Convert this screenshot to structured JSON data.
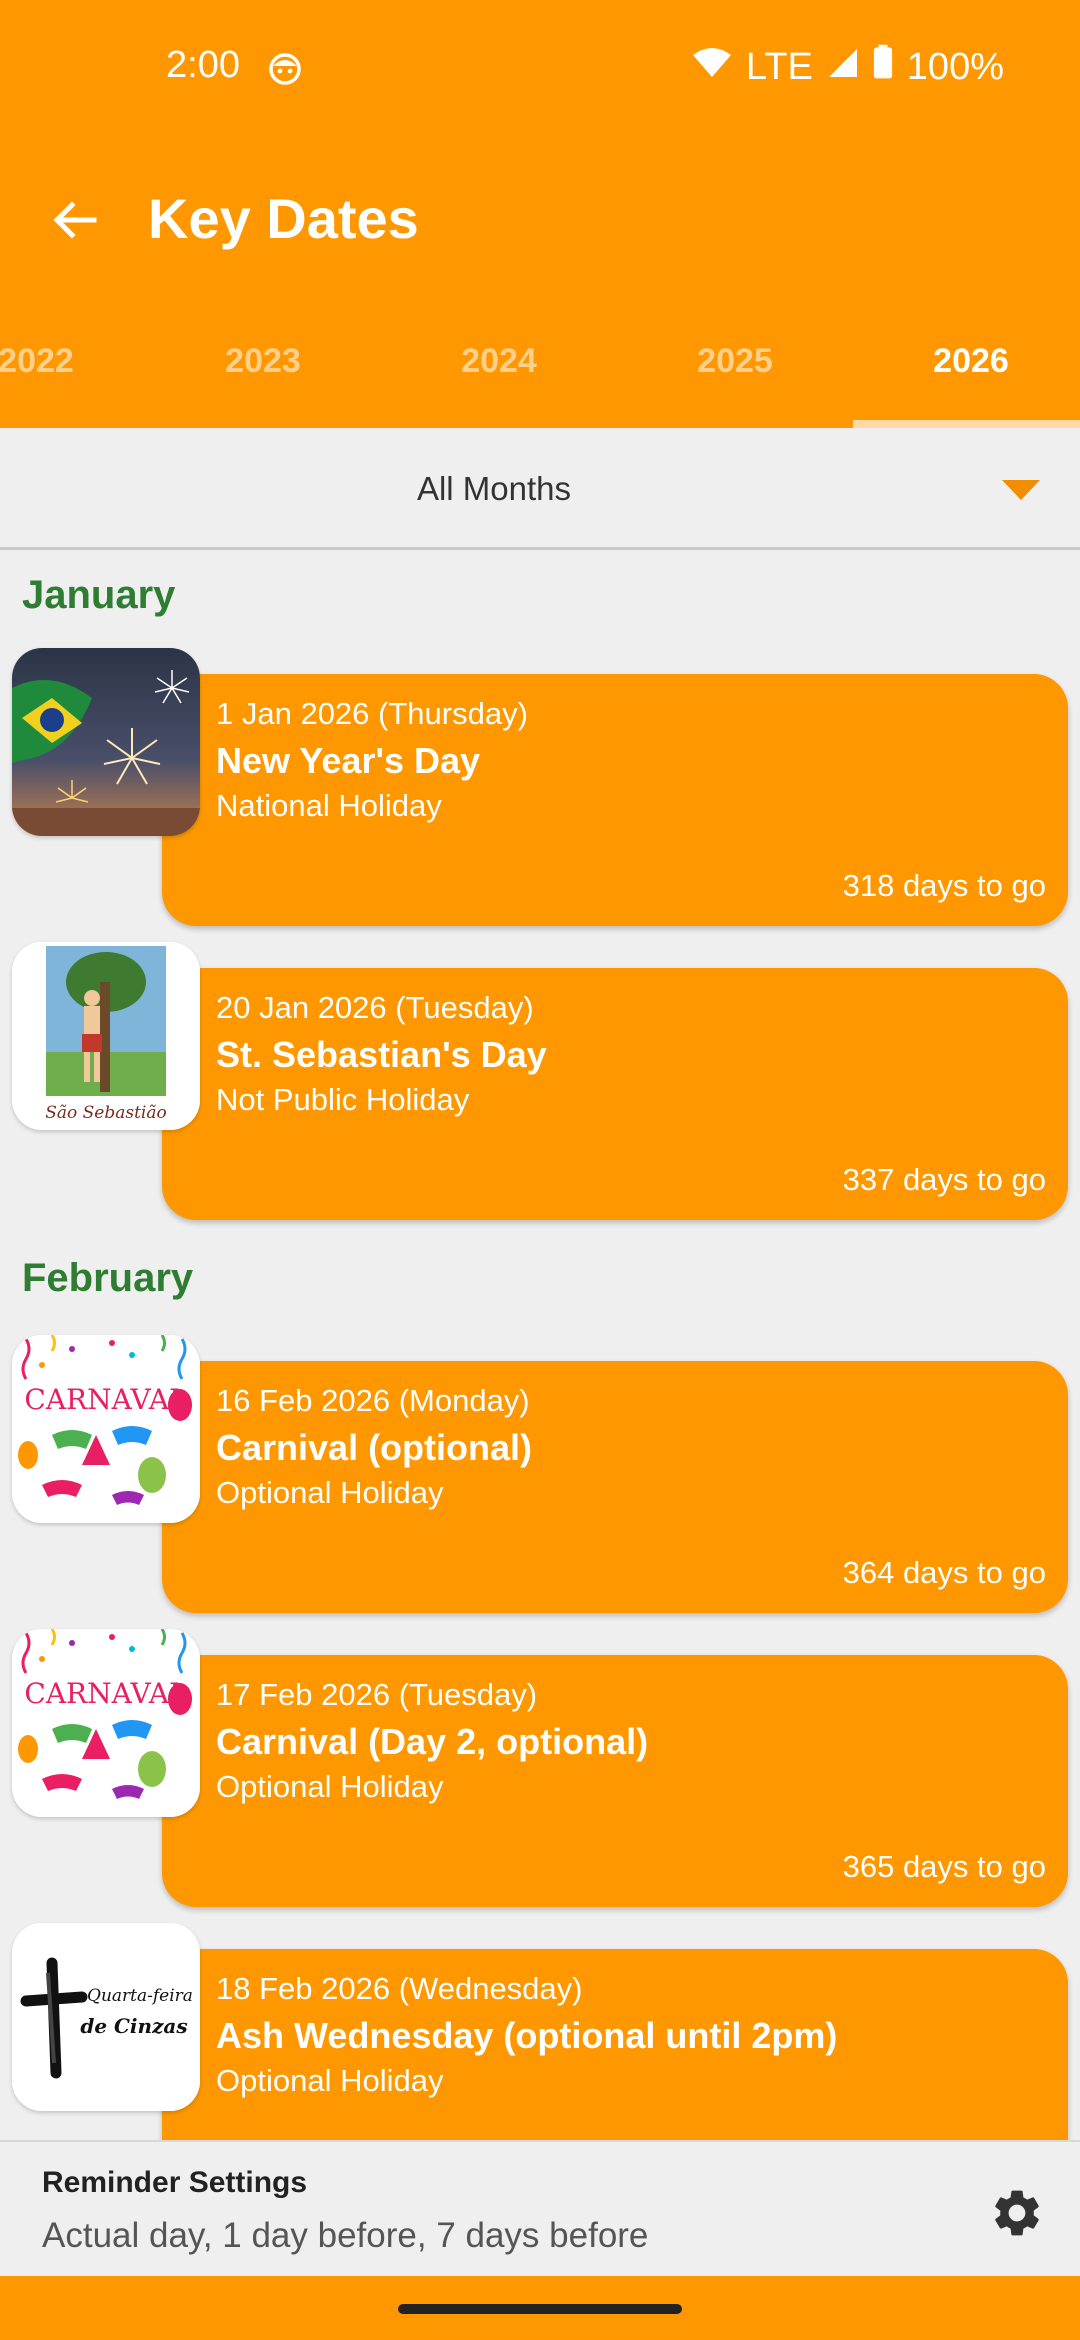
{
  "status": {
    "time": "2:00",
    "network": "LTE",
    "battery": "100%"
  },
  "toolbar": {
    "title": "Key Dates"
  },
  "tabs": [
    {
      "label": "2022"
    },
    {
      "label": "2023"
    },
    {
      "label": "2024"
    },
    {
      "label": "2025"
    },
    {
      "label": "2026",
      "active": true
    }
  ],
  "filter": {
    "selected": "All Months"
  },
  "months": [
    {
      "name": "January"
    },
    {
      "name": "February"
    }
  ],
  "events": [
    {
      "date": "1 Jan 2026 (Thursday)",
      "name": "New Year's Day",
      "type": "National Holiday",
      "countdown": "318 days to go"
    },
    {
      "date": "20 Jan 2026 (Tuesday)",
      "name": "St. Sebastian's Day",
      "type": "Not Public Holiday",
      "countdown": "337 days to go",
      "image_caption": "São Sebastião"
    },
    {
      "date": "16 Feb 2026 (Monday)",
      "name": "Carnival (optional)",
      "type": "Optional Holiday",
      "countdown": "364 days to go",
      "image_caption": "CARNAVAL"
    },
    {
      "date": "17 Feb 2026 (Tuesday)",
      "name": "Carnival (Day 2, optional)",
      "type": "Optional Holiday",
      "countdown": "365 days to go",
      "image_caption": "CARNAVAL"
    },
    {
      "date": "18 Feb 2026 (Wednesday)",
      "name": "Ash Wednesday (optional until 2pm)",
      "type": "Optional Holiday",
      "countdown": "",
      "image_caption": "Quarta-feira de Cinzas"
    }
  ],
  "reminder": {
    "title": "Reminder Settings",
    "value": "Actual day, 1 day before, 7 days before"
  },
  "colors": {
    "accent": "#ff9800",
    "month_header": "#2e7d32",
    "caret": "#f28c00"
  },
  "icons": {
    "back": "arrow-left-icon",
    "dropdown": "caret-down-icon",
    "settings": "gear-icon"
  }
}
